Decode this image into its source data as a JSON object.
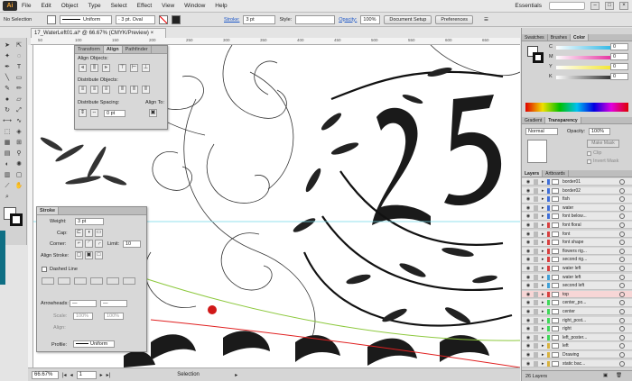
{
  "menubar": {
    "app_logo": "Ai",
    "items": [
      "File",
      "Edit",
      "Object",
      "Type",
      "Select",
      "Effect",
      "View",
      "Window",
      "Help"
    ],
    "workspace": "Essentials"
  },
  "control_bar": {
    "selection_label": "No Selection",
    "stroke_profile": "Uniform",
    "brush": "3 pt. Oval",
    "stroke_link": "Stroke:",
    "stroke_weight": "3 pt",
    "style_label": "Style:",
    "opacity_link": "Opacity:",
    "opacity_value": "100%",
    "document_setup": "Document Setup",
    "preferences": "Preferences"
  },
  "document": {
    "tab_title": "17_WaterLeft01.ai* @ 66.67% (CMYK/Preview)",
    "zoom": "66.67%",
    "artboard": "1",
    "status": "Selection",
    "ruler_marks": [
      "50",
      "100",
      "150",
      "200",
      "250",
      "300",
      "350",
      "400",
      "450",
      "500",
      "550",
      "600",
      "650"
    ]
  },
  "align_panel": {
    "tabs": [
      "Transform",
      "Align",
      "Pathfinder"
    ],
    "align_objects": "Align Objects:",
    "distribute_objects": "Distribute Objects:",
    "distribute_spacing": "Distribute Spacing:",
    "spacing_value": "0 pt",
    "align_to": "Align To:"
  },
  "stroke_panel": {
    "tabs": [
      "Stroke"
    ],
    "weight_label": "Weight:",
    "weight_value": "3 pt",
    "cap_label": "Cap:",
    "corner_label": "Corner:",
    "limit_label": "Limit:",
    "limit_value": "10",
    "align_stroke_label": "Align Stroke:",
    "dashed_line_label": "Dashed Line",
    "arrowheads_label": "Arrowheads:",
    "scale_label": "Scale:",
    "scale_value1": "100%",
    "scale_value2": "100%",
    "align_label": "Align:",
    "profile_label": "Profile:",
    "profile_value": "Uniform"
  },
  "swatches_panel": {
    "tabs": [
      "Swatches",
      "Brushes",
      "Color"
    ],
    "channels": [
      "C",
      "M",
      "Y",
      "K"
    ],
    "channel_values": [
      "0",
      "0",
      "0",
      "0"
    ]
  },
  "transparency_panel": {
    "tabs": [
      "Gradient",
      "Transparency"
    ],
    "blend_mode": "Normal",
    "opacity_label": "Opacity:",
    "opacity_value": "100%",
    "make_mask": "Make Mask",
    "clip": "Clip",
    "invert_mask": "Invert Mask"
  },
  "layers_panel": {
    "tabs": [
      "Layers",
      "Artboards"
    ],
    "layers": [
      {
        "name": "border01",
        "color": "#3f6fd8"
      },
      {
        "name": "border02",
        "color": "#3f6fd8"
      },
      {
        "name": "fish",
        "color": "#3f6fd8"
      },
      {
        "name": "water",
        "color": "#3f6fd8"
      },
      {
        "name": "font below...",
        "color": "#3f6fd8"
      },
      {
        "name": "font floral",
        "color": "#d83f3f"
      },
      {
        "name": "font",
        "color": "#d83f3f"
      },
      {
        "name": "font shape",
        "color": "#d83f3f"
      },
      {
        "name": "flowers rig...",
        "color": "#d83f3f"
      },
      {
        "name": "second rig...",
        "color": "#d83f3f"
      },
      {
        "name": "water left",
        "color": "#d83f3f"
      },
      {
        "name": "water left",
        "color": "#3fa0d8"
      },
      {
        "name": "second left",
        "color": "#3fa0d8"
      },
      {
        "name": "top",
        "color": "#d83f3f",
        "selected": true
      },
      {
        "name": "center_po...",
        "color": "#3fd85a"
      },
      {
        "name": "center",
        "color": "#3fd85a"
      },
      {
        "name": "right_post...",
        "color": "#3fd85a"
      },
      {
        "name": "right",
        "color": "#3fd85a"
      },
      {
        "name": "left_poster...",
        "color": "#3fd85a"
      },
      {
        "name": "left",
        "color": "#d8b23f"
      },
      {
        "name": "Drawing",
        "color": "#d8b23f"
      },
      {
        "name": "static bac...",
        "color": "#d8b23f"
      }
    ],
    "count": "26 Layers"
  },
  "colors": {
    "accent_blue": "#3f6fd8",
    "guide_cyan": "#6fd8e8",
    "green_curve": "#8cc83c",
    "red_curve": "#e02020"
  }
}
